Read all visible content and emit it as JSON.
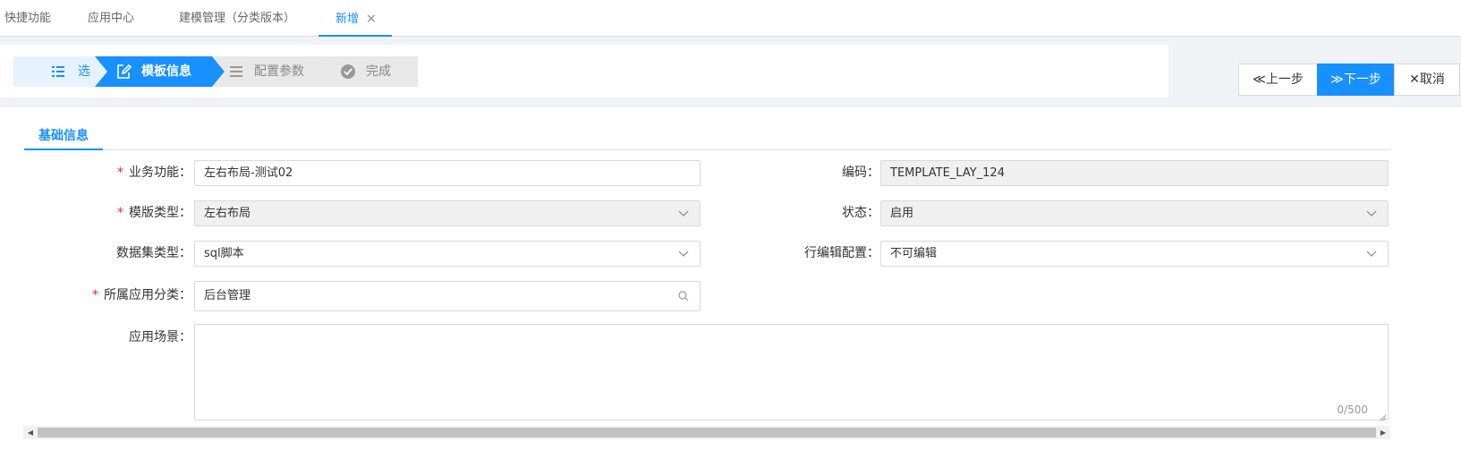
{
  "tabs": [
    {
      "label": "快捷功能"
    },
    {
      "label": "应用中心"
    },
    {
      "label": "建模管理（分类版本）"
    },
    {
      "label": "新增",
      "close_glyph": "×"
    }
  ],
  "steps": [
    {
      "label": "选",
      "icon": "list-icon",
      "state": "done"
    },
    {
      "label": "模板信息",
      "icon": "edit-icon",
      "state": "active"
    },
    {
      "label": "配置参数",
      "icon": "list-icon",
      "state": "pending"
    },
    {
      "label": "完成",
      "icon": "check-circle-icon",
      "state": "pending"
    }
  ],
  "actions": {
    "prev_label": "上一步",
    "next_label": "下一步",
    "cancel_label": "取消"
  },
  "section": {
    "title": "基础信息"
  },
  "form": {
    "business_function": {
      "label": "业务功能：",
      "value": "左右布局-测试02",
      "required": true
    },
    "code": {
      "label": "编码：",
      "value": "TEMPLATE_LAY_124"
    },
    "template_type": {
      "label": "模版类型：",
      "value": "左右布局",
      "required": true
    },
    "status": {
      "label": "状态：",
      "value": "启用"
    },
    "dataset_type": {
      "label": "数据集类型：",
      "value": "sql脚本"
    },
    "row_edit": {
      "label": "行编辑配置：",
      "value": "不可编辑"
    },
    "app_category": {
      "label": "所属应用分类：",
      "value": "后台管理",
      "required": true
    },
    "scenario": {
      "label": "应用场景：",
      "value": "",
      "counter": "0/500"
    }
  },
  "colors": {
    "primary": "#1890ff",
    "required": "#f5222d",
    "disabled_bg": "#f0f0f0"
  }
}
